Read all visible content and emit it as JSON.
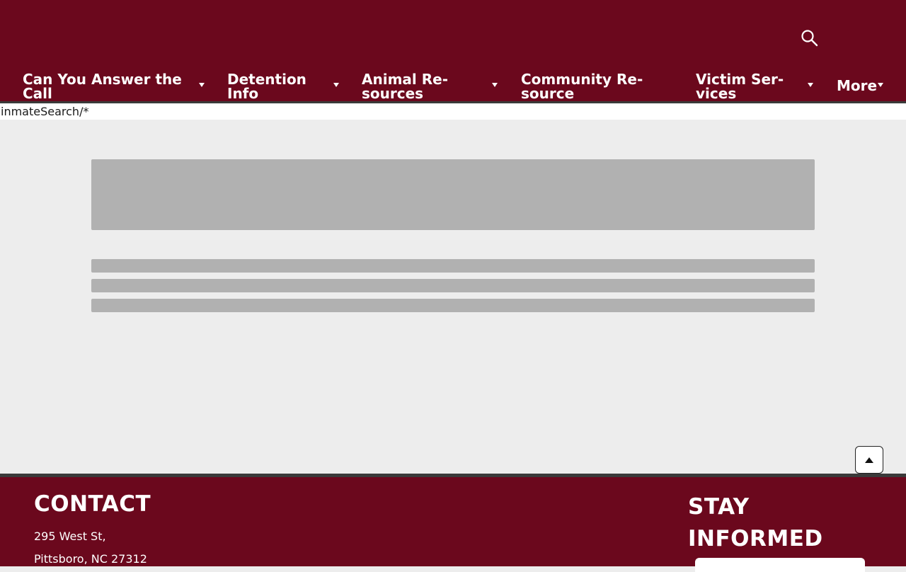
{
  "header": {
    "search_icon": "search-icon",
    "nav": [
      {
        "label": "Can You Answer the\nCall"
      },
      {
        "label": "Detention\nInfo"
      },
      {
        "label": "Animal Re-\nsources"
      },
      {
        "label": "Community Re-\nsource"
      },
      {
        "label": "Victim Ser-\nvices"
      },
      {
        "label": "More"
      }
    ]
  },
  "url_text": "inmateSearch/*",
  "footer": {
    "contact_title": "CONTACT",
    "address_line1": "295 West St,",
    "address_line2": "Pittsboro, NC 27312",
    "stay_title": "STAY INFORMED"
  },
  "colors": {
    "brand": "#6b081d",
    "page_bg": "#ededed",
    "skeleton": "#b1b1b1"
  }
}
